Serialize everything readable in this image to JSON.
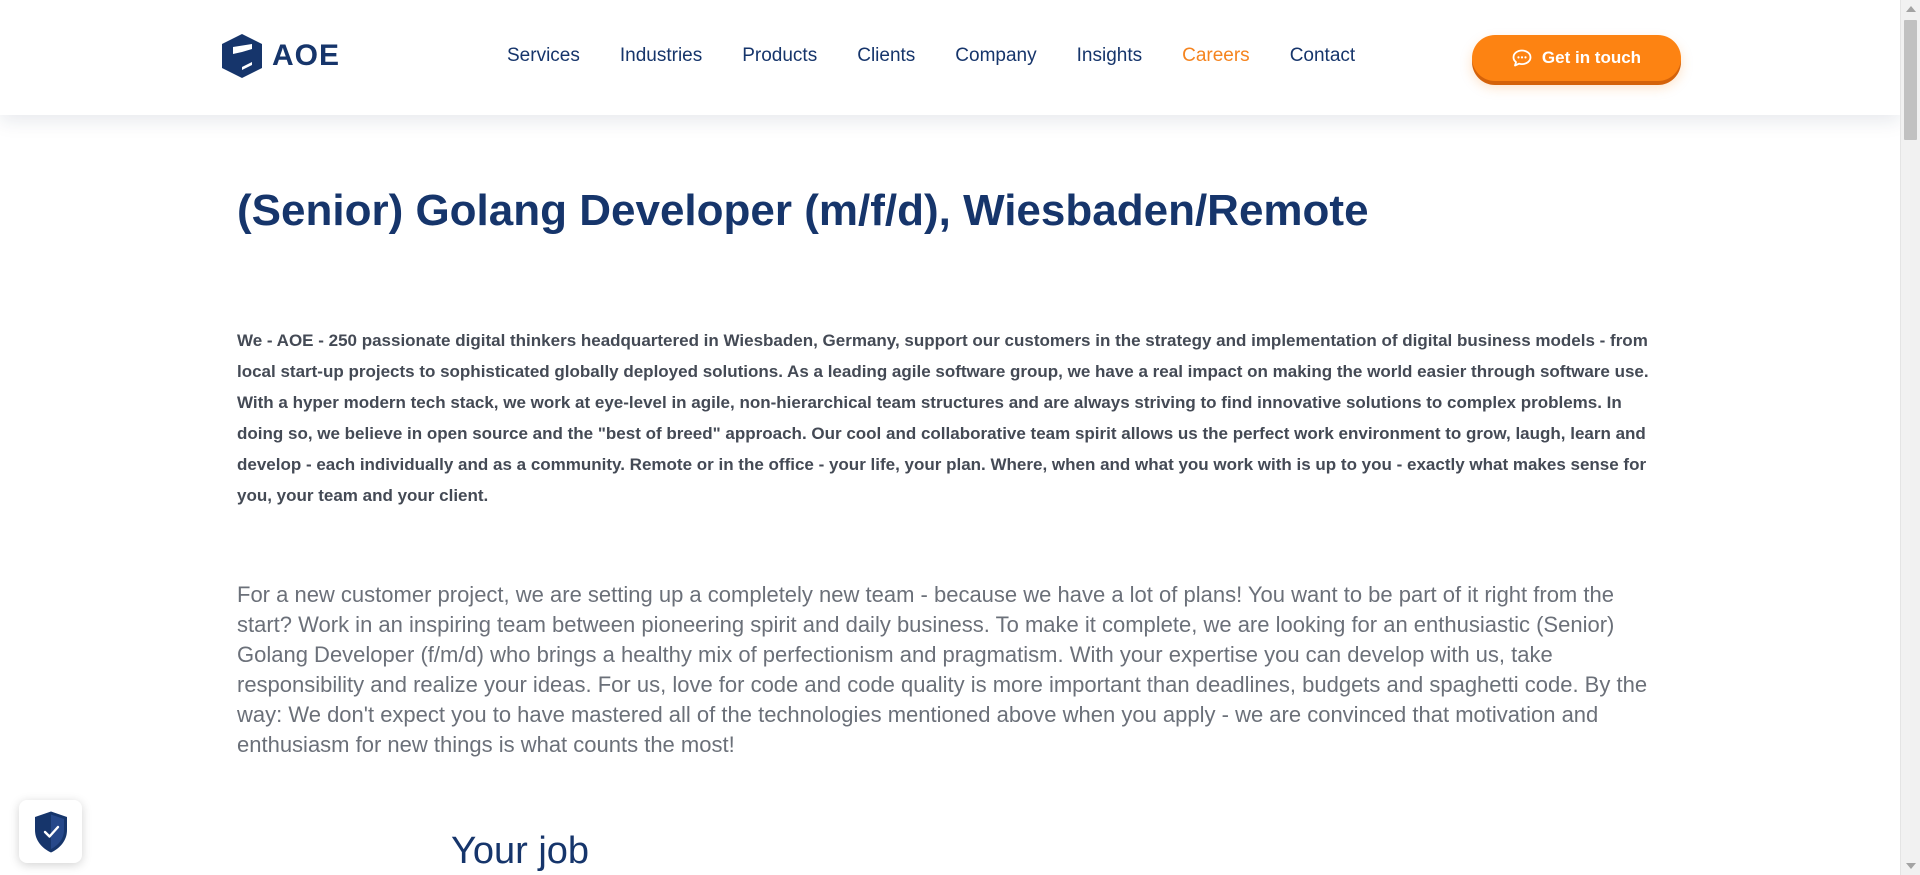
{
  "header": {
    "logo_text": "AOE",
    "nav": [
      {
        "label": "Services",
        "active": false
      },
      {
        "label": "Industries",
        "active": false
      },
      {
        "label": "Products",
        "active": false
      },
      {
        "label": "Clients",
        "active": false
      },
      {
        "label": "Company",
        "active": false
      },
      {
        "label": "Insights",
        "active": false
      },
      {
        "label": "Careers",
        "active": true
      },
      {
        "label": "Contact",
        "active": false
      }
    ],
    "cta_label": "Get in touch",
    "cta_icon": "chat-bubble-icon"
  },
  "main": {
    "title": "(Senior) Golang Developer (m/f/d), Wiesbaden/Remote",
    "intro": "We - AOE - 250 passionate digital thinkers headquartered in Wiesbaden, Germany, support our customers in the strategy and implementation of digital business models - from local start-up projects to sophisticated globally deployed solutions. As a leading agile software group, we have a real impact on making the world easier through software use. With a hyper modern tech stack, we work at eye-level in agile, non-hierarchical team structures and are always striving to find innovative solutions to complex problems. In doing so, we believe in open source and the \"best of breed\" approach. Our cool and collaborative team spirit allows us the perfect work environment to grow, laugh, learn and develop - each individually and as a community. Remote or in the office - your life, your plan. Where, when and what you work with is up to you - exactly what makes sense for you, your team and your client.",
    "lead": "For a new customer project, we are setting up a completely new team - because we have a lot of plans! You want to be part of it right from the start? Work in an inspiring team between pioneering spirit and daily business. To make it complete, we are looking for an enthusiastic (Senior) Golang Developer (f/m/d) who brings a healthy mix of perfectionism and pragmatism. With your expertise you can develop with us, take responsibility and realize your ideas. For us, love for code and code quality is more important than deadlines, budgets and spaghetti code. By the way: We don't expect you to have mastered all of the technologies mentioned above when you apply - we are convinced that motivation and enthusiasm for new things is what counts the most!",
    "section_title": "Your job"
  },
  "privacy_badge": {
    "icon": "shield-check-icon"
  },
  "colors": {
    "brand_navy": "#16356b",
    "accent_orange": "#fd8312",
    "active_nav": "#f5841f",
    "body_text": "#444a55",
    "lead_text": "#6b7079"
  }
}
